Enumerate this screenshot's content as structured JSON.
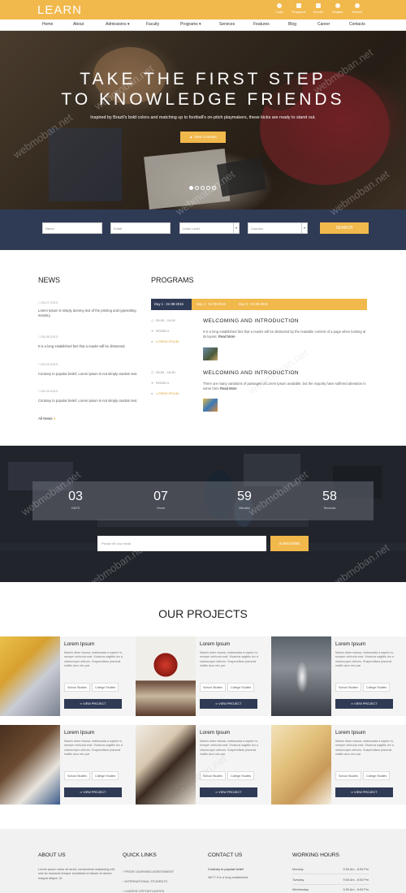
{
  "brand": {
    "logo": "LEARN",
    "accent": "#f1b84b",
    "navy": "#2f3a55"
  },
  "topbar_icons": [
    {
      "icon": "user-icon",
      "label": "Login"
    },
    {
      "icon": "programs-icon",
      "label": "Programs"
    },
    {
      "icon": "calendar-icon",
      "label": "Events"
    },
    {
      "icon": "globe-icon",
      "label": "English"
    },
    {
      "icon": "search-icon",
      "label": "Search"
    }
  ],
  "nav": [
    "Home",
    "About",
    "Admissions ▾",
    "Faculty",
    "Programs ▾",
    "Services",
    "Features",
    "Blog",
    "Career",
    "Contacts"
  ],
  "hero": {
    "title_line1": "TAKE THE FIRST STEP",
    "title_line2": "TO KNOWLEDGE FRIENDS",
    "subtitle": "Inspired by Brazil's bold colors and matching up to football's on-pitch playmakers, these kicks are ready to stand out.",
    "button": "View Courses",
    "slides": 5,
    "active_slide": 1
  },
  "search": {
    "name_placeholder": "Name",
    "email_placeholder": "Email",
    "level_value": "Learn Level",
    "courses_value": "Courses",
    "button": "SEARCH"
  },
  "news": {
    "title": "NEWS",
    "items": [
      {
        "date": "05-27-2013",
        "text": "Lorem Ipsum is simply dummy text of the printing and typesetting industry."
      },
      {
        "date": "05-28-2013",
        "text": "It is a long established fact that a reader will be distracted."
      },
      {
        "date": "05-24-2013",
        "text": "Contrary to popular belief, Lorem Ipsum is not simply random text."
      },
      {
        "date": "05-24-2013",
        "text": "Contrary to popular belief, Lorem Ipsum is not simply random text."
      }
    ],
    "all_news": "All News"
  },
  "programs": {
    "title": "PROGRAMS",
    "tabs": [
      "Day 1 : 31-08-2015",
      "Day 2 : 01-09-2015",
      "Day 3 : 01-09-2015"
    ],
    "active_tab": 0,
    "items": [
      {
        "time": "09:00 - 10:30",
        "room": "ROOM 4",
        "person": "LOREM IPSUM",
        "title": "WELCOMING AND INTRODUCTION",
        "text": "It is a long established fact that a reader will be distracted by the readable content of a page when looking at its layout.",
        "read_more": "Read More"
      },
      {
        "time": "09:00 - 10:30",
        "room": "ROOM 4",
        "person": "LOREM IPSUM",
        "title": "WELCOMING AND INTRODUCTION",
        "text": "There are many variations of passages of Lorem Ipsum available, but the majority have suffered alteration in some form",
        "read_more": "Read More"
      }
    ]
  },
  "countdown": [
    {
      "value": "03",
      "label": "DAYS"
    },
    {
      "value": "07",
      "label": "Hours"
    },
    {
      "value": "59",
      "label": "Minutes"
    },
    {
      "value": "58",
      "label": "Seconds"
    }
  ],
  "subscribe": {
    "placeholder": "Please fill now email",
    "button": "SUBSCRIBE"
  },
  "projects": {
    "title": "OUR PROJECTS",
    "cards": [
      {
        "title": "Lorem Ipsum",
        "text": "Mauris diam massa, malesuada a sapien in, semper vehicula erat. Vivamus sagittis leo a ullamcorper ultrices. Suspendisse placerat mattis arcu nec par",
        "tags": [
          "School Studies",
          "College Studies"
        ],
        "button": "VIEW PROJECT"
      },
      {
        "title": "Lorem Ipsum",
        "text": "Mauris diam massa, malesuada a sapien in, semper vehicula erat. Vivamus sagittis leo a ullamcorper ultrices. Suspendisse placerat mattis arcu nec par",
        "tags": [
          "School Studies",
          "College Studies"
        ],
        "button": "VIEW PROJECT"
      },
      {
        "title": "Lorem Ipsum",
        "text": "Mauris diam massa, malesuada a sapien in, semper vehicula erat. Vivamus sagittis leo a ullamcorper ultrices. Suspendisse placerat mattis arcu nec par",
        "tags": [
          "School Studies",
          "College Studies"
        ],
        "button": "VIEW PROJECT"
      },
      {
        "title": "Lorem Ipsum",
        "text": "Mauris diam massa, malesuada a sapien in, semper vehicula erat. Vivamus sagittis leo a ullamcorper ultrices. Suspendisse placerat mattis arcu nec par",
        "tags": [
          "School Studies",
          "College Studies"
        ],
        "button": "VIEW PROJECT"
      },
      {
        "title": "Lorem Ipsum",
        "text": "Mauris diam massa, malesuada a sapien in, semper vehicula erat. Vivamus sagittis leo a ullamcorper ultrices. Suspendisse placerat mattis arcu nec par",
        "tags": [
          "School Studies",
          "College Studies"
        ],
        "button": "VIEW PROJECT"
      },
      {
        "title": "Lorem Ipsum",
        "text": "Mauris diam massa, malesuada a sapien in, semper vehicula erat. Vivamus sagittis leo a ullamcorper ultrices. Suspendisse placerat mattis arcu nec par",
        "tags": [
          "School Studies",
          "College Studies"
        ],
        "button": "VIEW PROJECT"
      }
    ]
  },
  "footer": {
    "about": {
      "title": "ABOUT US",
      "text": "Lorem ipsum dolor sit amet, consectetur adipiscing elit, sed do eiusmod tempor incididunt ut labore et dolore magna aliqua. Ut"
    },
    "quick_links": {
      "title": "QUICK LINKS",
      "items": [
        "PRIOR LEARNING ASSESSMENT",
        "INTERNATIONAL STUDENTS",
        "CAREER OPPORTUNITIES"
      ]
    },
    "contact": {
      "title": "CONTACT US",
      "lead": "Contrary to popular belief",
      "text": "48/77 It is a long established"
    },
    "hours": {
      "title": "WORKING HOURS",
      "rows": [
        {
          "day": "Monday",
          "time": "9:30 Am - 6:00 Pm"
        },
        {
          "day": "Tuesday",
          "time": "9:30 Am - 6:00 Pm"
        },
        {
          "day": "Wednesday",
          "time": "9:30 Am - 6:00 Pm"
        }
      ]
    }
  },
  "watermark": "webmoban.net"
}
